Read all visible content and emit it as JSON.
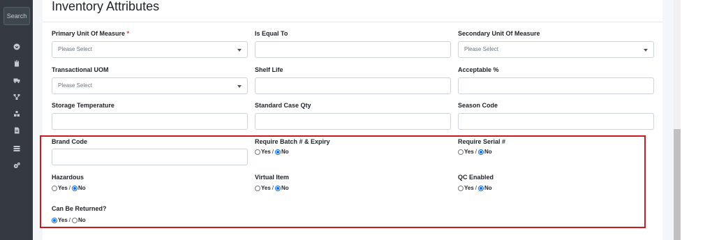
{
  "sidebar": {
    "search_label": "Search",
    "icons": [
      "dashboard-icon",
      "clipboard-icon",
      "truck-icon",
      "sitemap-icon",
      "warehouse-icon",
      "document-icon",
      "list-icon",
      "settings-icon"
    ]
  },
  "section": {
    "title": "Inventory Attributes"
  },
  "fields": {
    "primary_uom": {
      "label": "Primary Unit Of Measure",
      "required_mark": "*",
      "placeholder": "Please Select"
    },
    "is_equal_to": {
      "label": "Is Equal To",
      "value": ""
    },
    "secondary_uom": {
      "label": "Secondary Unit Of Measure",
      "placeholder": "Please Select"
    },
    "transactional_uom": {
      "label": "Transactional UOM",
      "placeholder": "Please Select"
    },
    "shelf_life": {
      "label": "Shelf Life",
      "value": ""
    },
    "acceptable_pct": {
      "label": "Acceptable %",
      "value": ""
    },
    "storage_temperature": {
      "label": "Storage Temperature",
      "value": ""
    },
    "standard_case_qty": {
      "label": "Standard Case Qty",
      "value": ""
    },
    "season_code": {
      "label": "Season Code",
      "value": ""
    },
    "brand_code": {
      "label": "Brand Code",
      "value": ""
    },
    "require_batch_expiry": {
      "label": "Require Batch # & Expiry",
      "selected": "No"
    },
    "require_serial": {
      "label": "Require Serial #",
      "selected": "No"
    },
    "hazardous": {
      "label": "Hazardous",
      "selected": "No"
    },
    "virtual_item": {
      "label": "Virtual Item",
      "selected": "No"
    },
    "qc_enabled": {
      "label": "QC Enabled",
      "selected": "No"
    },
    "can_be_returned": {
      "label": "Can Be Returned?",
      "selected": "Yes"
    }
  },
  "radio_options": {
    "yes": "Yes",
    "no": "No",
    "separator": "/"
  },
  "colors": {
    "sidebar_bg": "#343a40",
    "highlight_border": "#c91a1f",
    "radio_accent": "#0d6efd",
    "required": "#dc3545"
  }
}
